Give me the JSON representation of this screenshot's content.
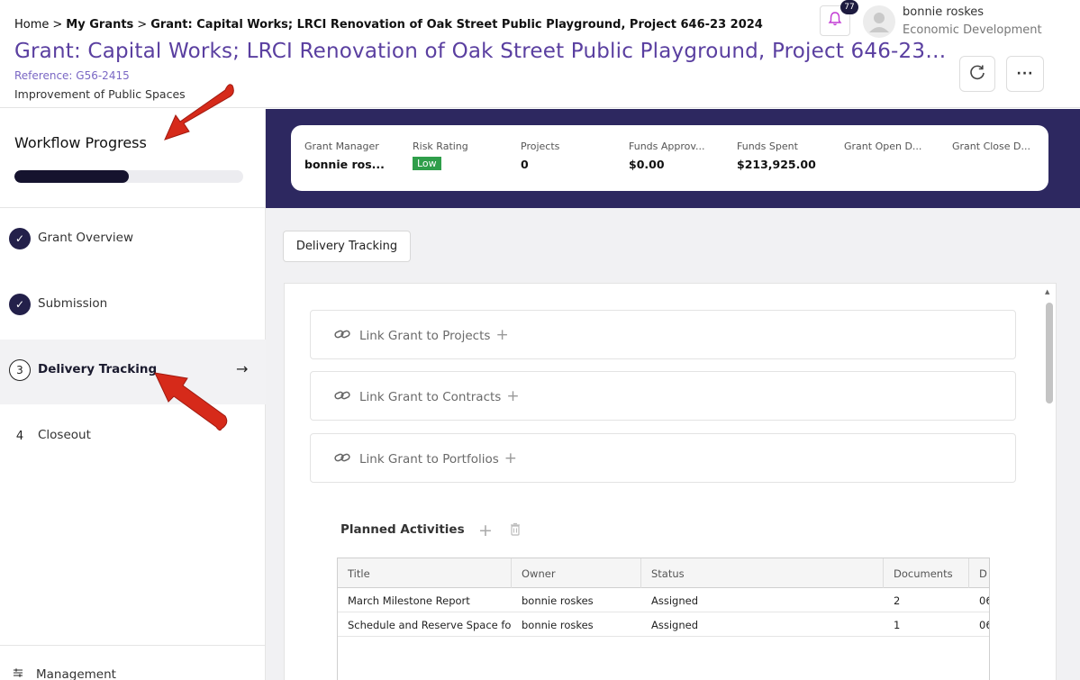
{
  "breadcrumb": {
    "home": "Home",
    "sep": ">",
    "my_grants": "My Grants",
    "current": "Grant: Capital Works; LRCI Renovation of Oak Street Public Playground, Project 646-23 2024"
  },
  "header": {
    "title": "Grant: Capital Works; LRCI Renovation of Oak Street Public Playground, Project 646-23 2024",
    "reference": "Reference: G56-2415",
    "subtitle": "Improvement of Public Spaces",
    "notification_count": "77",
    "user_name": "bonnie roskes",
    "user_dept": "Economic Development",
    "more_label": "···"
  },
  "sidebar": {
    "workflow_title": "Workflow Progress",
    "workflow_progress": 0.5,
    "steps": [
      {
        "label": "Grant Overview",
        "number": "1",
        "state": "done"
      },
      {
        "label": "Submission",
        "number": "2",
        "state": "done"
      },
      {
        "label": "Delivery Tracking",
        "number": "3",
        "state": "active"
      },
      {
        "label": "Closeout",
        "number": "4",
        "state": "pending"
      }
    ],
    "management_label": "Management"
  },
  "summary": {
    "stats": [
      {
        "label": "Grant Manager",
        "value": "bonnie ros..."
      },
      {
        "label": "Risk Rating",
        "value": "Low"
      },
      {
        "label": "Projects",
        "value": "0"
      },
      {
        "label": "Funds Approv...",
        "value": "$0.00"
      },
      {
        "label": "Funds Spent",
        "value": "$213,925.00"
      },
      {
        "label": "Grant Open D...",
        "value": ""
      },
      {
        "label": "Grant Close D...",
        "value": ""
      }
    ],
    "risk_color": "#2f9e4a"
  },
  "main": {
    "tab_label": "Delivery Tracking",
    "links": [
      {
        "label": "Link Grant to Projects",
        "icon": "link-icon"
      },
      {
        "label": "Link Grant to Contracts",
        "icon": "link-icon"
      },
      {
        "label": "Link Grant to Portfolios",
        "icon": "link-icon"
      }
    ],
    "planned_title": "Planned Activities",
    "table": {
      "columns": [
        "Title",
        "Owner",
        "Status",
        "Documents",
        "D"
      ],
      "rows": [
        [
          "March Milestone Report",
          "bonnie roskes",
          "Assigned",
          "2",
          "06"
        ],
        [
          "Schedule and Reserve Space fo...",
          "bonnie roskes",
          "Assigned",
          "1",
          "06"
        ]
      ]
    }
  },
  "colors": {
    "brand_purple": "#5a3fa0",
    "band": "#2d2860",
    "dark_navy": "#15132e",
    "annotation_red": "#d62a1a"
  }
}
